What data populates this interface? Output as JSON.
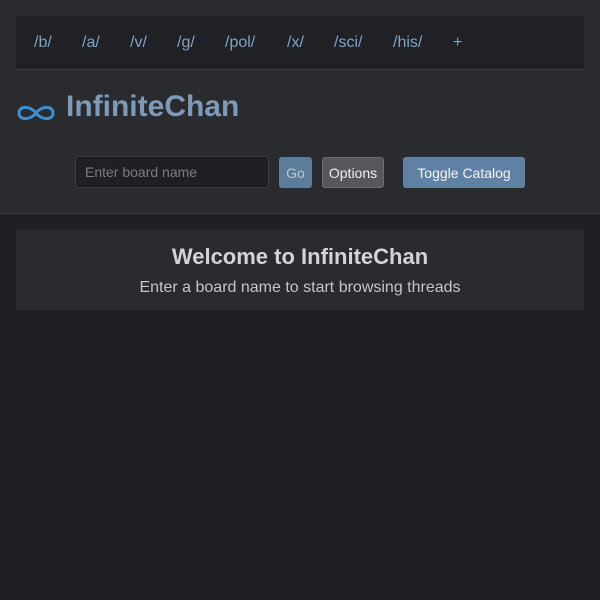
{
  "nav": {
    "boards": [
      "/b/",
      "/a/",
      "/v/",
      "/g/",
      "/pol/",
      "/x/",
      "/sci/",
      "/his/"
    ],
    "add_label": "+"
  },
  "header": {
    "title": "InfiniteChan",
    "logo_icon": "infinity-icon"
  },
  "controls": {
    "board_input_placeholder": "Enter board name",
    "board_input_value": "",
    "go_label": "Go",
    "options_label": "Options",
    "toggle_catalog_label": "Toggle Catalog"
  },
  "welcome": {
    "title": "Welcome to InfiniteChan",
    "subtitle": "Enter a board name to start browsing threads"
  },
  "colors": {
    "accent": "#7d9bb9",
    "link": "#7fa3c6",
    "logo": "#3d8fd1",
    "background": "#1f2023",
    "panel": "#2a2b2f"
  }
}
